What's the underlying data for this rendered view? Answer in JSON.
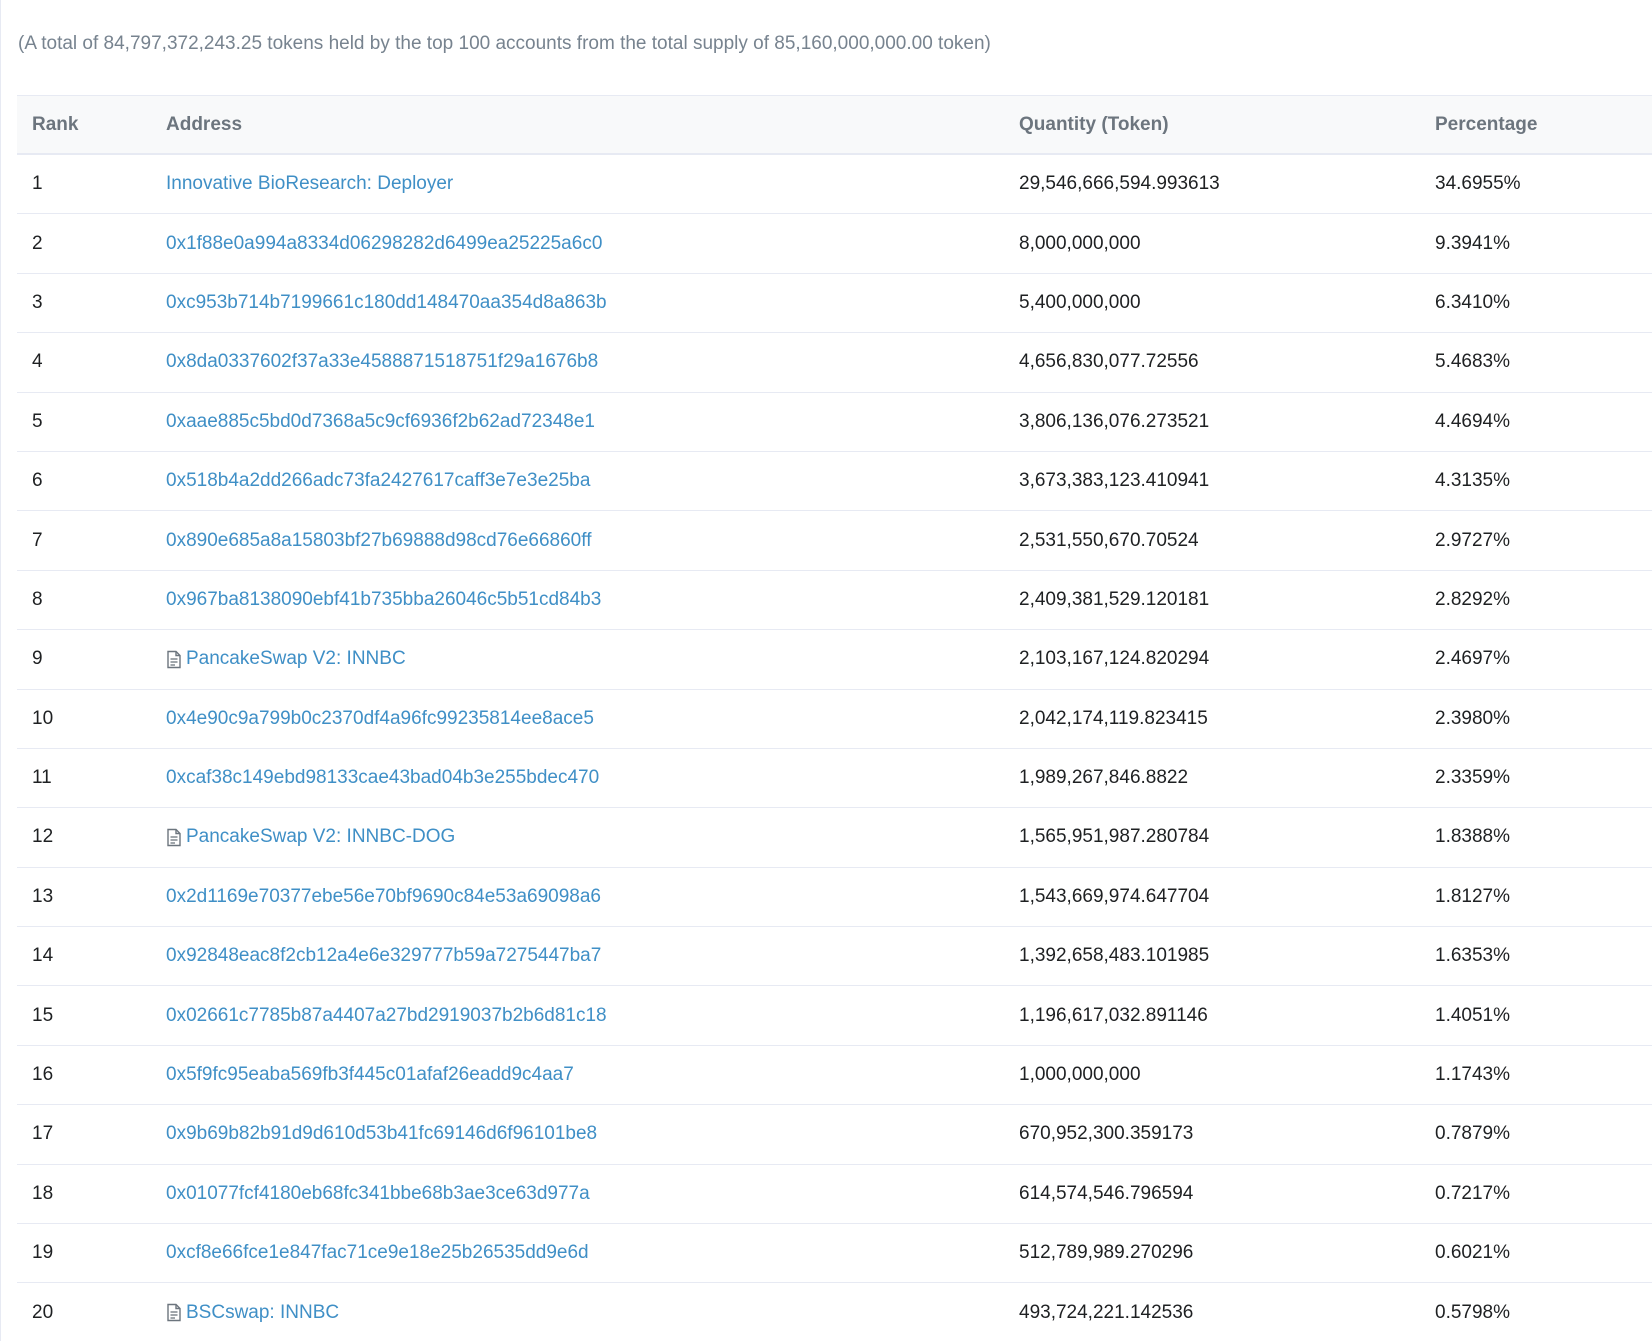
{
  "summary": "(A total of 84,797,372,243.25 tokens held by the top 100 accounts from the total supply of 85,160,000,000.00 token)",
  "columns": {
    "rank": "Rank",
    "address": "Address",
    "quantity": "Quantity (Token)",
    "percentage": "Percentage"
  },
  "rows": [
    {
      "rank": "1",
      "address": "Innovative BioResearch: Deployer",
      "contract": false,
      "quantity": "29,546,666,594.993613",
      "percentage": "34.6955%"
    },
    {
      "rank": "2",
      "address": "0x1f88e0a994a8334d06298282d6499ea25225a6c0",
      "contract": false,
      "quantity": "8,000,000,000",
      "percentage": "9.3941%"
    },
    {
      "rank": "3",
      "address": "0xc953b714b7199661c180dd148470aa354d8a863b",
      "contract": false,
      "quantity": "5,400,000,000",
      "percentage": "6.3410%"
    },
    {
      "rank": "4",
      "address": "0x8da0337602f37a33e4588871518751f29a1676b8",
      "contract": false,
      "quantity": "4,656,830,077.72556",
      "percentage": "5.4683%"
    },
    {
      "rank": "5",
      "address": "0xaae885c5bd0d7368a5c9cf6936f2b62ad72348e1",
      "contract": false,
      "quantity": "3,806,136,076.273521",
      "percentage": "4.4694%"
    },
    {
      "rank": "6",
      "address": "0x518b4a2dd266adc73fa2427617caff3e7e3e25ba",
      "contract": false,
      "quantity": "3,673,383,123.410941",
      "percentage": "4.3135%"
    },
    {
      "rank": "7",
      "address": "0x890e685a8a15803bf27b69888d98cd76e66860ff",
      "contract": false,
      "quantity": "2,531,550,670.70524",
      "percentage": "2.9727%"
    },
    {
      "rank": "8",
      "address": "0x967ba8138090ebf41b735bba26046c5b51cd84b3",
      "contract": false,
      "quantity": "2,409,381,529.120181",
      "percentage": "2.8292%"
    },
    {
      "rank": "9",
      "address": "PancakeSwap V2: INNBC",
      "contract": true,
      "quantity": "2,103,167,124.820294",
      "percentage": "2.4697%"
    },
    {
      "rank": "10",
      "address": "0x4e90c9a799b0c2370df4a96fc99235814ee8ace5",
      "contract": false,
      "quantity": "2,042,174,119.823415",
      "percentage": "2.3980%"
    },
    {
      "rank": "11",
      "address": "0xcaf38c149ebd98133cae43bad04b3e255bdec470",
      "contract": false,
      "quantity": "1,989,267,846.8822",
      "percentage": "2.3359%"
    },
    {
      "rank": "12",
      "address": "PancakeSwap V2: INNBC-DOG",
      "contract": true,
      "quantity": "1,565,951,987.280784",
      "percentage": "1.8388%"
    },
    {
      "rank": "13",
      "address": "0x2d1169e70377ebe56e70bf9690c84e53a69098a6",
      "contract": false,
      "quantity": "1,543,669,974.647704",
      "percentage": "1.8127%"
    },
    {
      "rank": "14",
      "address": "0x92848eac8f2cb12a4e6e329777b59a7275447ba7",
      "contract": false,
      "quantity": "1,392,658,483.101985",
      "percentage": "1.6353%"
    },
    {
      "rank": "15",
      "address": "0x02661c7785b87a4407a27bd2919037b2b6d81c18",
      "contract": false,
      "quantity": "1,196,617,032.891146",
      "percentage": "1.4051%"
    },
    {
      "rank": "16",
      "address": "0x5f9fc95eaba569fb3f445c01afaf26eadd9c4aa7",
      "contract": false,
      "quantity": "1,000,000,000",
      "percentage": "1.1743%"
    },
    {
      "rank": "17",
      "address": "0x9b69b82b91d9d610d53b41fc69146d6f96101be8",
      "contract": false,
      "quantity": "670,952,300.359173",
      "percentage": "0.7879%"
    },
    {
      "rank": "18",
      "address": "0x01077fcf4180eb68fc341bbe68b3ae3ce63d977a",
      "contract": false,
      "quantity": "614,574,546.796594",
      "percentage": "0.7217%"
    },
    {
      "rank": "19",
      "address": "0xcf8e66fce1e847fac71ce9e18e25b26535dd9e6d",
      "contract": false,
      "quantity": "512,789,989.270296",
      "percentage": "0.6021%"
    },
    {
      "rank": "20",
      "address": "BSCswap: INNBC",
      "contract": true,
      "quantity": "493,724,221.142536",
      "percentage": "0.5798%"
    }
  ],
  "icons": {
    "contract": "document-icon"
  },
  "colors": {
    "link": "#3f8fc6",
    "muted": "#77838f",
    "border": "#e7eaf3",
    "header_bg": "#f8f9fa"
  }
}
